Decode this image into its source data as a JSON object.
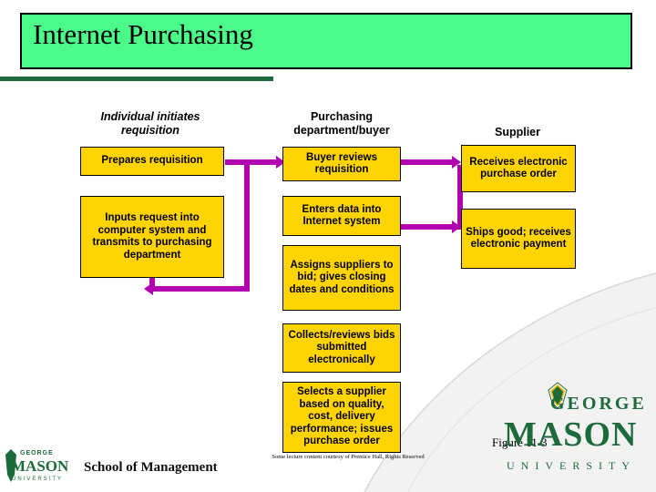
{
  "slide": {
    "title": "Internet Purchasing",
    "figure_caption": "Figure 11-3",
    "credit": "Some lecture content courtesy of Prentice Hall, Rights Reserved",
    "colors": {
      "title_fill": "#4CFA8A",
      "title_border": "#000000",
      "box_fill": "#FFD400",
      "box_border": "#000000",
      "connector": "#B000B0",
      "brand_green": "#1D6B3A"
    }
  },
  "columns": [
    {
      "id": "individual",
      "label": "Individual initiates requisition"
    },
    {
      "id": "purchasing",
      "label": "Purchasing department/buyer"
    },
    {
      "id": "supplier",
      "label": "Supplier"
    }
  ],
  "boxes": [
    {
      "id": "prepares-requisition",
      "column": "individual",
      "text": "Prepares requisition"
    },
    {
      "id": "inputs-request",
      "column": "individual",
      "text": "Inputs request into computer system and transmits to purchasing department"
    },
    {
      "id": "buyer-reviews",
      "column": "purchasing",
      "text": "Buyer reviews requisition"
    },
    {
      "id": "enters-data",
      "column": "purchasing",
      "text": "Enters data into Internet system"
    },
    {
      "id": "assigns-suppliers",
      "column": "purchasing",
      "text": "Assigns suppliers to bid; gives closing dates and conditions"
    },
    {
      "id": "collects-reviews-bids",
      "column": "purchasing",
      "text": "Collects/reviews bids submitted electronically"
    },
    {
      "id": "selects-supplier",
      "column": "purchasing",
      "text": "Selects a supplier based on quality, cost, delivery performance; issues purchase order"
    },
    {
      "id": "receives-po",
      "column": "supplier",
      "text": "Receives electronic purchase order"
    },
    {
      "id": "ships-goods",
      "column": "supplier",
      "text": "Ships good; receives electronic payment"
    }
  ],
  "logos": {
    "left": {
      "george": "GEORGE",
      "mason": "MASON",
      "university": "UNIVERSITY",
      "school": "School of Management"
    },
    "right": {
      "george": "GEORGE",
      "mason": "MASON",
      "university": "UNIVERSITY"
    }
  }
}
